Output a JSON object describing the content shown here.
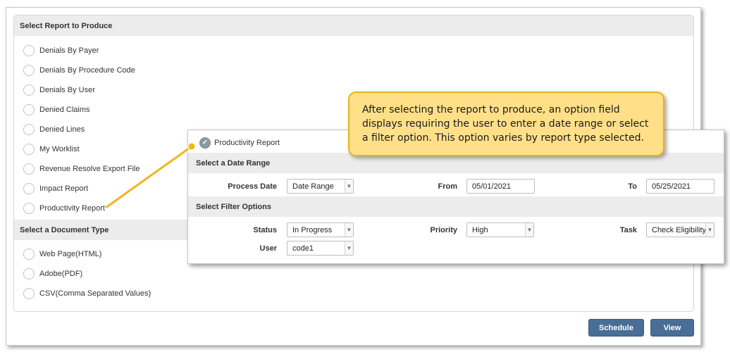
{
  "report_section": {
    "header": "Select Report to Produce",
    "options": [
      "Denials By Payer",
      "Denials By Procedure Code",
      "Denials By User",
      "Denied Claims",
      "Denied Lines",
      "My Worklist",
      "Revenue Resolve Export File",
      "Impact Report",
      "Productivity Report"
    ]
  },
  "document_section": {
    "header": "Select a Document Type",
    "options": [
      "Web Page(HTML)",
      "Adobe(PDF)",
      "CSV(Comma Separated Values)"
    ]
  },
  "buttons": {
    "schedule": "Schedule",
    "view": "View"
  },
  "option_panel": {
    "selected_report": "Productivity Report",
    "date_header": "Select a Date Range",
    "process_date_label": "Process Date",
    "process_date_value": "Date Range",
    "from_label": "From",
    "from_value": "05/01/2021",
    "to_label": "To",
    "to_value": "05/25/2021",
    "filter_header": "Select Filter Options",
    "status_label": "Status",
    "status_value": "In Progress",
    "priority_label": "Priority",
    "priority_value": "High",
    "task_label": "Task",
    "task_value": "Check Eligibility",
    "user_label": "User",
    "user_value": "code1"
  },
  "callout": {
    "text": "After selecting the report to produce, an option field displays requiring the user to enter a date range or select a filter option.  This option varies by report type selected."
  },
  "colors": {
    "button": "#486e96",
    "callout_fill": "#ffe089",
    "callout_border": "#e8b21f",
    "section_header": "#ececec"
  }
}
